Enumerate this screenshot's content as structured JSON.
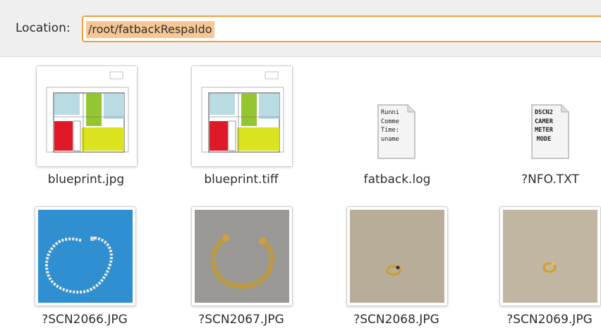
{
  "location": {
    "label": "Location:",
    "path": "/root/fatbackRespaldo"
  },
  "files": [
    {
      "name": "blueprint.jpg",
      "kind": "image",
      "preview": "floorplan"
    },
    {
      "name": "blueprint.tiff",
      "kind": "image",
      "preview": "floorplan"
    },
    {
      "name": "fatback.log",
      "kind": "text",
      "preview_lines": [
        "Runni",
        "Comme",
        "Time:",
        "uname"
      ]
    },
    {
      "name": "?NFO.TXT",
      "kind": "text",
      "preview_lines": [
        "DSCN2",
        "CAMER",
        "METER",
        "MODE"
      ]
    },
    {
      "name": "?SCN2066.JPG",
      "kind": "image",
      "preview": "pearl-necklace"
    },
    {
      "name": "?SCN2067.JPG",
      "kind": "image",
      "preview": "gold-bracelet"
    },
    {
      "name": "?SCN2068.JPG",
      "kind": "image",
      "preview": "gold-ring"
    },
    {
      "name": "?SCN2069.JPG",
      "kind": "image",
      "preview": "gold-ring"
    }
  ],
  "colors": {
    "location_focus_border": "#f2a03d",
    "location_selection": "#f6c795"
  }
}
